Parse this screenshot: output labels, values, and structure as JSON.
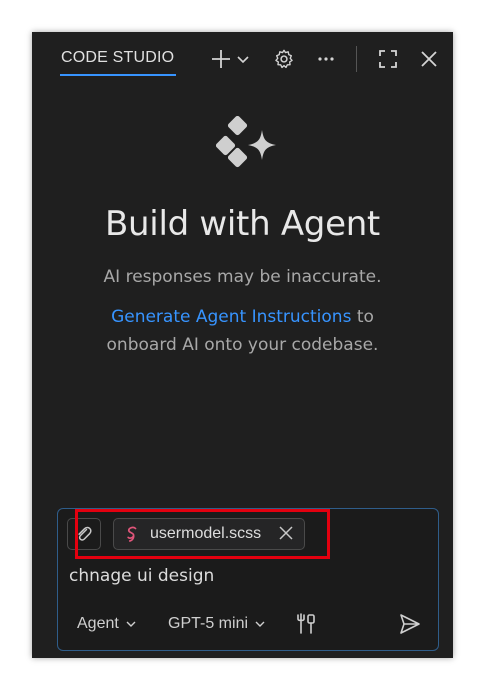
{
  "header": {
    "title": "CODE STUDIO",
    "icons": [
      "plus-icon",
      "chevron-down-icon",
      "gear-icon",
      "more-icon",
      "maximize-icon",
      "close-icon"
    ]
  },
  "hero": {
    "title": "Build with Agent",
    "disclaimer": "AI responses may be inaccurate.",
    "instructions_link": "Generate Agent Instructions",
    "instructions_after": " to",
    "instructions_line2": "onboard AI onto your codebase."
  },
  "input": {
    "attachment_chip": "usermodel.scss",
    "prompt_text": "chnage ui design",
    "mode_label": "Agent",
    "model_label": "GPT-5 mini"
  },
  "colors": {
    "accent": "#3794ff",
    "highlight": "#e3000f",
    "scss_icon": "#e0557a",
    "panel_bg": "#1f1f1f"
  }
}
